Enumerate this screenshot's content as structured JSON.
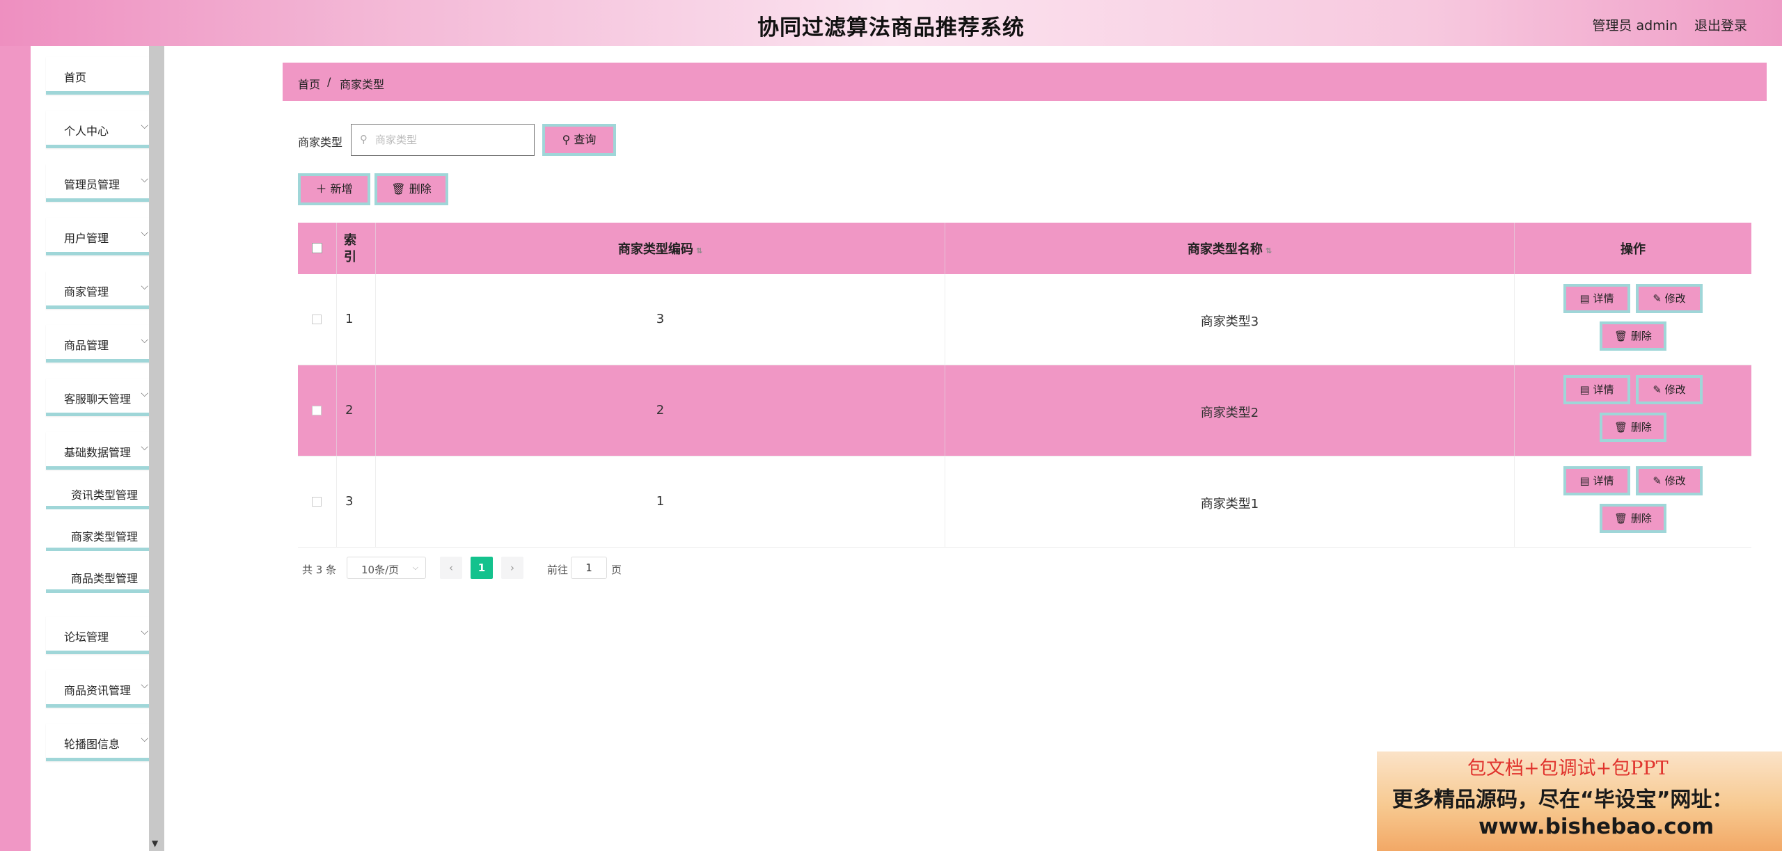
{
  "header": {
    "title": "协同过滤算法商品推荐系统",
    "user": "管理员 admin",
    "logout": "退出登录"
  },
  "sidebar": {
    "items": [
      {
        "label": "首页",
        "icon": "none"
      },
      {
        "label": "个人中心",
        "icon": "chevron-down"
      },
      {
        "label": "管理员管理",
        "icon": "chevron-down"
      },
      {
        "label": "用户管理",
        "icon": "chevron-down"
      },
      {
        "label": "商家管理",
        "icon": "chevron-down"
      },
      {
        "label": "商品管理",
        "icon": "chevron-down"
      },
      {
        "label": "客服聊天管理",
        "icon": "chevron-down"
      },
      {
        "label": "基础数据管理",
        "icon": "chevron-down"
      },
      {
        "label": "论坛管理",
        "icon": "chevron-down"
      },
      {
        "label": "商品资讯管理",
        "icon": "chevron-down"
      },
      {
        "label": "轮播图信息",
        "icon": "chevron-down"
      }
    ],
    "subitems": [
      {
        "label": "资讯类型管理"
      },
      {
        "label": "商家类型管理"
      },
      {
        "label": "商品类型管理"
      }
    ]
  },
  "breadcrumb": {
    "home": "首页",
    "sep": "/",
    "current": "商家类型"
  },
  "search": {
    "label": "商家类型",
    "placeholder": "商家类型",
    "value": "",
    "button": "查询"
  },
  "toolbar": {
    "add": "新增",
    "delete": "删除"
  },
  "table": {
    "headers": {
      "index": "索引",
      "code": "商家类型编码",
      "name": "商家类型名称",
      "actions": "操作"
    },
    "rows": [
      {
        "index": "1",
        "code": "3",
        "name": "商家类型3"
      },
      {
        "index": "2",
        "code": "2",
        "name": "商家类型2"
      },
      {
        "index": "3",
        "code": "1",
        "name": "商家类型1"
      }
    ],
    "actions": {
      "detail": "详情",
      "edit": "修改",
      "delete": "删除"
    }
  },
  "pagination": {
    "total": "共 3 条",
    "page_size": "10条/页",
    "current_page": "1",
    "goto_label": "前往",
    "goto_value": "1",
    "page_suffix": "页"
  },
  "ad": {
    "line1": "包文档+包调试+包PPT",
    "line2": "更多精品源码，尽在“毕设宝”网址：",
    "line3": "www.bishebao.com"
  },
  "colors": {
    "primary": "#f097c5",
    "accent_border": "#9fd6d8",
    "active_page": "#14c28d"
  }
}
